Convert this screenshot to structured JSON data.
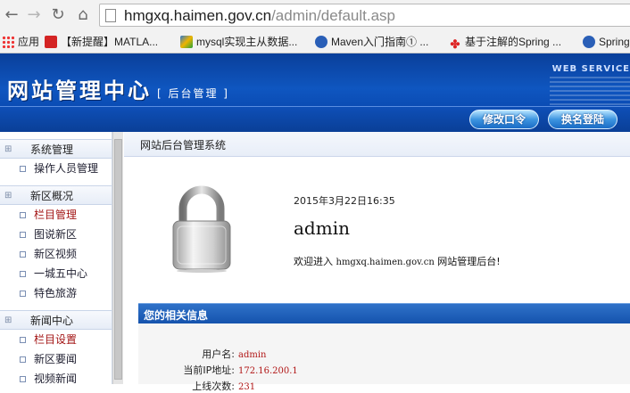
{
  "browser": {
    "url_host": "hmgxq.haimen.gov.cn",
    "url_path": "/admin/default.asp",
    "bookmarks": [
      {
        "label": "应用",
        "icon": "apps-grid-icon"
      },
      {
        "label": "【新提醒】MATLA...",
        "icon": "bookmark-red-icon"
      },
      {
        "label": "mysql实现主从数据...",
        "icon": "bookmark-colorful-icon"
      },
      {
        "label": "Maven入门指南① ...",
        "icon": "bookmark-blue-globe-icon"
      },
      {
        "label": "基于注解的Spring ...",
        "icon": "bookmark-red-logo-icon"
      },
      {
        "label": "Spring",
        "icon": "bookmark-blue-globe-icon"
      }
    ]
  },
  "header": {
    "title": "网站管理中心",
    "subtitle": "[ 后台管理 ]",
    "web_services": "WEB SERVICE",
    "buttons": {
      "change_password": "修改口令",
      "switch_login": "换名登陆"
    }
  },
  "sidebar": {
    "sections": [
      {
        "title": "系统管理",
        "items": [
          {
            "label": "操作人员管理",
            "active": false
          }
        ]
      },
      {
        "title": "新区概况",
        "items": [
          {
            "label": "栏目管理",
            "active": true
          },
          {
            "label": "图说新区",
            "active": false
          },
          {
            "label": "新区视频",
            "active": false
          },
          {
            "label": "一城五中心",
            "active": false
          },
          {
            "label": "特色旅游",
            "active": false
          }
        ]
      },
      {
        "title": "新闻中心",
        "items": [
          {
            "label": "栏目设置",
            "active": true
          },
          {
            "label": "新区要闻",
            "active": false
          },
          {
            "label": "视频新闻",
            "active": false
          }
        ]
      }
    ]
  },
  "main": {
    "heading": "网站后台管理系统",
    "datetime": "2015年3月22日16:35",
    "username": "admin",
    "welcome_prefix": "欢迎进入 ",
    "welcome_host": "hmgxq.haimen.gov.cn",
    "welcome_suffix": " 网站管理后台!",
    "info_title": "您的相关信息",
    "info": [
      {
        "key": "用户名:",
        "value": "admin"
      },
      {
        "key": "当前IP地址:",
        "value": "172.16.200.1"
      },
      {
        "key": "上线次数:",
        "value": "231"
      }
    ]
  },
  "colors": {
    "header_blue": "#0f56c0",
    "active_link": "#a31515",
    "info_value": "#b11616"
  }
}
